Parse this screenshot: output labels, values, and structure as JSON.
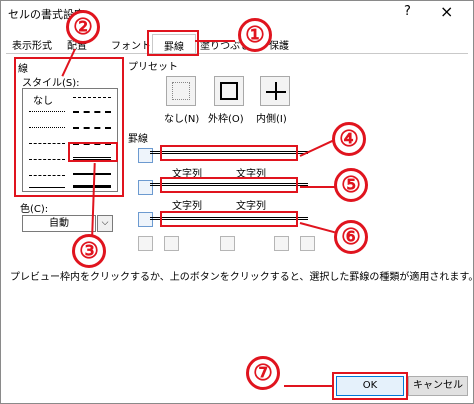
{
  "window": {
    "title": "セルの書式設定",
    "help": "?",
    "close": "×"
  },
  "tabs": [
    "表示形式",
    "配置",
    "フォント",
    "罫線",
    "塗りつぶし",
    "保護"
  ],
  "line_group": {
    "label": "線",
    "style_label": "スタイル(S):",
    "none": "なし"
  },
  "color": {
    "label": "色(C):",
    "value": "自動",
    "dropdown": "⌵"
  },
  "presets": {
    "label": "プリセット",
    "none": "なし(N)",
    "outline": "外枠(O)",
    "inside": "内側(I)"
  },
  "border": {
    "label": "罫線",
    "cell_text": "文字列"
  },
  "note": "プレビュー枠内をクリックするか、上のボタンをクリックすると、選択した罫線の種類が適用されます。",
  "buttons": {
    "ok": "OK",
    "cancel": "キャンセル"
  },
  "markers": [
    "①",
    "②",
    "③",
    "④",
    "⑤",
    "⑥",
    "⑦"
  ],
  "colors": {
    "annotation": "#e0141e",
    "accent": "#0078d7"
  }
}
